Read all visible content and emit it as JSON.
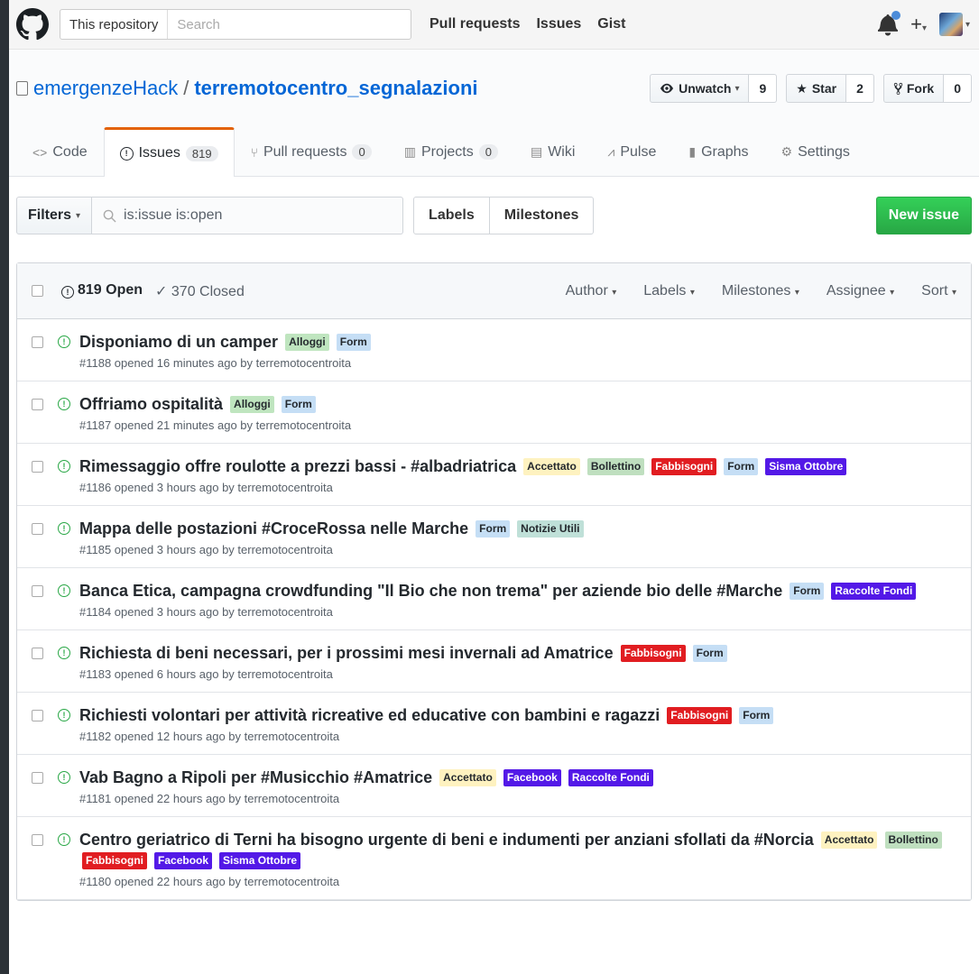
{
  "header": {
    "search_scope": "This repository",
    "search_placeholder": "Search",
    "nav": [
      "Pull requests",
      "Issues",
      "Gist"
    ]
  },
  "repo": {
    "owner": "emergenzeHack",
    "name": "terremotocentro_segnalazioni",
    "watch_label": "Unwatch",
    "watch_count": "9",
    "star_label": "Star",
    "star_count": "2",
    "fork_label": "Fork",
    "fork_count": "0"
  },
  "tabs": [
    {
      "label": "Code",
      "icon": "code-icon"
    },
    {
      "label": "Issues",
      "count": "819",
      "icon": "issue-opened-icon"
    },
    {
      "label": "Pull requests",
      "count": "0",
      "icon": "git-pull-request-icon"
    },
    {
      "label": "Projects",
      "count": "0",
      "icon": "project-icon"
    },
    {
      "label": "Wiki",
      "icon": "book-icon"
    },
    {
      "label": "Pulse",
      "icon": "pulse-icon"
    },
    {
      "label": "Graphs",
      "icon": "graph-icon"
    },
    {
      "label": "Settings",
      "icon": "gear-icon"
    }
  ],
  "subnav": {
    "filters_label": "Filters",
    "query": "is:issue is:open",
    "labels_label": "Labels",
    "milestones_label": "Milestones",
    "new_issue_label": "New issue"
  },
  "issues_header": {
    "open": "819 Open",
    "closed": "370 Closed",
    "sorters": [
      "Author",
      "Labels",
      "Milestones",
      "Assignee",
      "Sort"
    ]
  },
  "label_colors": {
    "Alloggi": {
      "bg": "#bfe5bf",
      "fg": "#24292e"
    },
    "Form": {
      "bg": "#c5def5",
      "fg": "#24292e"
    },
    "Accettato": {
      "bg": "#fef2c0",
      "fg": "#24292e"
    },
    "Bollettino": {
      "bg": "#bfdfbf",
      "fg": "#24292e"
    },
    "Fabbisogni": {
      "bg": "#e11d21",
      "fg": "#ffffff"
    },
    "Sisma Ottobre": {
      "bg": "#5319e7",
      "fg": "#ffffff"
    },
    "Notizie Utili": {
      "bg": "#bfe0d8",
      "fg": "#24292e"
    },
    "Raccolte Fondi": {
      "bg": "#5319e7",
      "fg": "#ffffff"
    },
    "Facebook": {
      "bg": "#5319e7",
      "fg": "#ffffff"
    }
  },
  "issues": [
    {
      "title": "Disponiamo di un camper",
      "labels": [
        "Alloggi",
        "Form"
      ],
      "meta": "#1188 opened 16 minutes ago by terremotocentroita"
    },
    {
      "title": "Offriamo ospitalità",
      "labels": [
        "Alloggi",
        "Form"
      ],
      "meta": "#1187 opened 21 minutes ago by terremotocentroita"
    },
    {
      "title": "Rimessaggio offre roulotte a prezzi bassi - #albadriatrica",
      "labels": [
        "Accettato",
        "Bollettino",
        "Fabbisogni",
        "Form",
        "Sisma Ottobre"
      ],
      "meta": "#1186 opened 3 hours ago by terremotocentroita"
    },
    {
      "title": "Mappa delle postazioni #CroceRossa nelle Marche",
      "labels": [
        "Form",
        "Notizie Utili"
      ],
      "meta": "#1185 opened 3 hours ago by terremotocentroita"
    },
    {
      "title": "Banca Etica, campagna crowdfunding \"Il Bio che non trema\" per aziende bio delle #Marche",
      "labels": [
        "Form",
        "Raccolte Fondi"
      ],
      "meta": "#1184 opened 3 hours ago by terremotocentroita"
    },
    {
      "title": "Richiesta di beni necessari, per i prossimi mesi invernali ad Amatrice",
      "labels": [
        "Fabbisogni",
        "Form"
      ],
      "meta": "#1183 opened 6 hours ago by terremotocentroita"
    },
    {
      "title": "Richiesti volontari per attività ricreative ed educative con bambini e ragazzi",
      "labels": [
        "Fabbisogni",
        "Form"
      ],
      "meta": "#1182 opened 12 hours ago by terremotocentroita"
    },
    {
      "title": "Vab Bagno a Ripoli per #Musicchio #Amatrice",
      "labels": [
        "Accettato",
        "Facebook",
        "Raccolte Fondi"
      ],
      "meta": "#1181 opened 22 hours ago by terremotocentroita"
    },
    {
      "title": "Centro geriatrico di Terni ha bisogno urgente di beni e indumenti per anziani sfollati da #Norcia",
      "labels": [
        "Accettato",
        "Bollettino",
        "Fabbisogni",
        "Facebook",
        "Sisma Ottobre"
      ],
      "meta": "#1180 opened 22 hours ago by terremotocentroita"
    }
  ]
}
